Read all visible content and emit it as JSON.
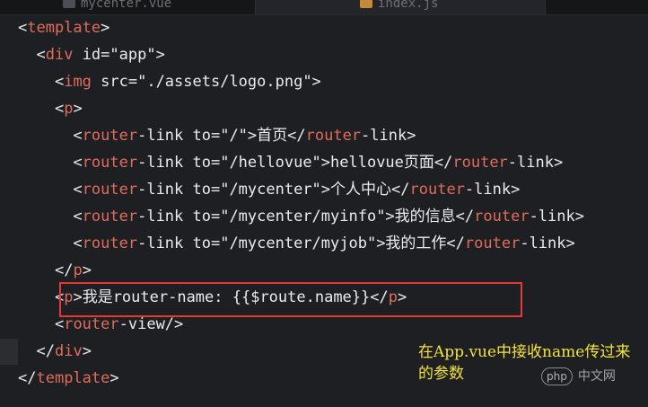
{
  "tabs": [
    {
      "label": "mycenter.vue"
    },
    {
      "label": "index.js"
    }
  ],
  "code_lines": [
    {
      "t": "<",
      "tag": "template",
      "close": ">"
    },
    {
      "indent": "  ",
      "open": "<",
      "tag": "div",
      "rest": " id=\"app\">"
    },
    {
      "indent": "    ",
      "open": "<",
      "tag": "img",
      "rest": " src=\"./assets/logo.png\">"
    },
    {
      "indent": "    ",
      "open": "<",
      "tag": "p",
      "rest": ">"
    },
    {
      "indent": "      ",
      "open": "<",
      "tag": "router",
      "rest": "-link to=\"/\">首页</",
      "tag2": "router",
      "rest2": "-link>"
    },
    {
      "indent": "      ",
      "open": "<",
      "tag": "router",
      "rest": "-link to=\"/hellovue\">hellovue页面</",
      "tag2": "router",
      "rest2": "-link>"
    },
    {
      "indent": "      ",
      "open": "<",
      "tag": "router",
      "rest": "-link to=\"/mycenter\">个人中心</",
      "tag2": "router",
      "rest2": "-link>"
    },
    {
      "indent": "      ",
      "open": "<",
      "tag": "router",
      "rest": "-link to=\"/mycenter/myinfo\">我的信息</",
      "tag2": "router",
      "rest2": "-link>"
    },
    {
      "indent": "      ",
      "open": "<",
      "tag": "router",
      "rest": "-link to=\"/mycenter/myjob\">我的工作</",
      "tag2": "router",
      "rest2": "-link>"
    },
    {
      "indent": "    ",
      "open": "</",
      "tag": "p",
      "rest": ">"
    },
    {
      "indent": "    ",
      "open": "<",
      "tag": "p",
      "rest": ">我是router-name: {{$route.name}}</",
      "tag2": "p",
      "rest2": ">"
    },
    {
      "indent": "    ",
      "open": "<",
      "tag": "router",
      "rest": "-view/>"
    },
    {
      "indent": "  ",
      "open": "</",
      "tag": "div",
      "rest": ">"
    },
    {
      "indent": "",
      "open": "</",
      "tag": "template",
      "rest": ">"
    }
  ],
  "annotation": {
    "text": "在App.vue中接收name传过来的参数"
  },
  "watermark": {
    "badge": "php",
    "text": "中文网"
  }
}
